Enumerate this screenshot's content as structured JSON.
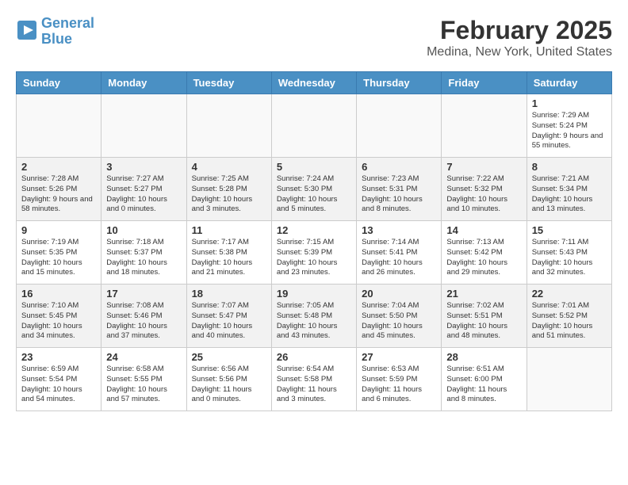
{
  "header": {
    "logo_line1": "General",
    "logo_line2": "Blue",
    "title": "February 2025",
    "subtitle": "Medina, New York, United States"
  },
  "weekdays": [
    "Sunday",
    "Monday",
    "Tuesday",
    "Wednesday",
    "Thursday",
    "Friday",
    "Saturday"
  ],
  "weeks": [
    [
      {
        "day": "",
        "info": ""
      },
      {
        "day": "",
        "info": ""
      },
      {
        "day": "",
        "info": ""
      },
      {
        "day": "",
        "info": ""
      },
      {
        "day": "",
        "info": ""
      },
      {
        "day": "",
        "info": ""
      },
      {
        "day": "1",
        "info": "Sunrise: 7:29 AM\nSunset: 5:24 PM\nDaylight: 9 hours and 55 minutes."
      }
    ],
    [
      {
        "day": "2",
        "info": "Sunrise: 7:28 AM\nSunset: 5:26 PM\nDaylight: 9 hours and 58 minutes."
      },
      {
        "day": "3",
        "info": "Sunrise: 7:27 AM\nSunset: 5:27 PM\nDaylight: 10 hours and 0 minutes."
      },
      {
        "day": "4",
        "info": "Sunrise: 7:25 AM\nSunset: 5:28 PM\nDaylight: 10 hours and 3 minutes."
      },
      {
        "day": "5",
        "info": "Sunrise: 7:24 AM\nSunset: 5:30 PM\nDaylight: 10 hours and 5 minutes."
      },
      {
        "day": "6",
        "info": "Sunrise: 7:23 AM\nSunset: 5:31 PM\nDaylight: 10 hours and 8 minutes."
      },
      {
        "day": "7",
        "info": "Sunrise: 7:22 AM\nSunset: 5:32 PM\nDaylight: 10 hours and 10 minutes."
      },
      {
        "day": "8",
        "info": "Sunrise: 7:21 AM\nSunset: 5:34 PM\nDaylight: 10 hours and 13 minutes."
      }
    ],
    [
      {
        "day": "9",
        "info": "Sunrise: 7:19 AM\nSunset: 5:35 PM\nDaylight: 10 hours and 15 minutes."
      },
      {
        "day": "10",
        "info": "Sunrise: 7:18 AM\nSunset: 5:37 PM\nDaylight: 10 hours and 18 minutes."
      },
      {
        "day": "11",
        "info": "Sunrise: 7:17 AM\nSunset: 5:38 PM\nDaylight: 10 hours and 21 minutes."
      },
      {
        "day": "12",
        "info": "Sunrise: 7:15 AM\nSunset: 5:39 PM\nDaylight: 10 hours and 23 minutes."
      },
      {
        "day": "13",
        "info": "Sunrise: 7:14 AM\nSunset: 5:41 PM\nDaylight: 10 hours and 26 minutes."
      },
      {
        "day": "14",
        "info": "Sunrise: 7:13 AM\nSunset: 5:42 PM\nDaylight: 10 hours and 29 minutes."
      },
      {
        "day": "15",
        "info": "Sunrise: 7:11 AM\nSunset: 5:43 PM\nDaylight: 10 hours and 32 minutes."
      }
    ],
    [
      {
        "day": "16",
        "info": "Sunrise: 7:10 AM\nSunset: 5:45 PM\nDaylight: 10 hours and 34 minutes."
      },
      {
        "day": "17",
        "info": "Sunrise: 7:08 AM\nSunset: 5:46 PM\nDaylight: 10 hours and 37 minutes."
      },
      {
        "day": "18",
        "info": "Sunrise: 7:07 AM\nSunset: 5:47 PM\nDaylight: 10 hours and 40 minutes."
      },
      {
        "day": "19",
        "info": "Sunrise: 7:05 AM\nSunset: 5:48 PM\nDaylight: 10 hours and 43 minutes."
      },
      {
        "day": "20",
        "info": "Sunrise: 7:04 AM\nSunset: 5:50 PM\nDaylight: 10 hours and 45 minutes."
      },
      {
        "day": "21",
        "info": "Sunrise: 7:02 AM\nSunset: 5:51 PM\nDaylight: 10 hours and 48 minutes."
      },
      {
        "day": "22",
        "info": "Sunrise: 7:01 AM\nSunset: 5:52 PM\nDaylight: 10 hours and 51 minutes."
      }
    ],
    [
      {
        "day": "23",
        "info": "Sunrise: 6:59 AM\nSunset: 5:54 PM\nDaylight: 10 hours and 54 minutes."
      },
      {
        "day": "24",
        "info": "Sunrise: 6:58 AM\nSunset: 5:55 PM\nDaylight: 10 hours and 57 minutes."
      },
      {
        "day": "25",
        "info": "Sunrise: 6:56 AM\nSunset: 5:56 PM\nDaylight: 11 hours and 0 minutes."
      },
      {
        "day": "26",
        "info": "Sunrise: 6:54 AM\nSunset: 5:58 PM\nDaylight: 11 hours and 3 minutes."
      },
      {
        "day": "27",
        "info": "Sunrise: 6:53 AM\nSunset: 5:59 PM\nDaylight: 11 hours and 6 minutes."
      },
      {
        "day": "28",
        "info": "Sunrise: 6:51 AM\nSunset: 6:00 PM\nDaylight: 11 hours and 8 minutes."
      },
      {
        "day": "",
        "info": ""
      }
    ]
  ]
}
